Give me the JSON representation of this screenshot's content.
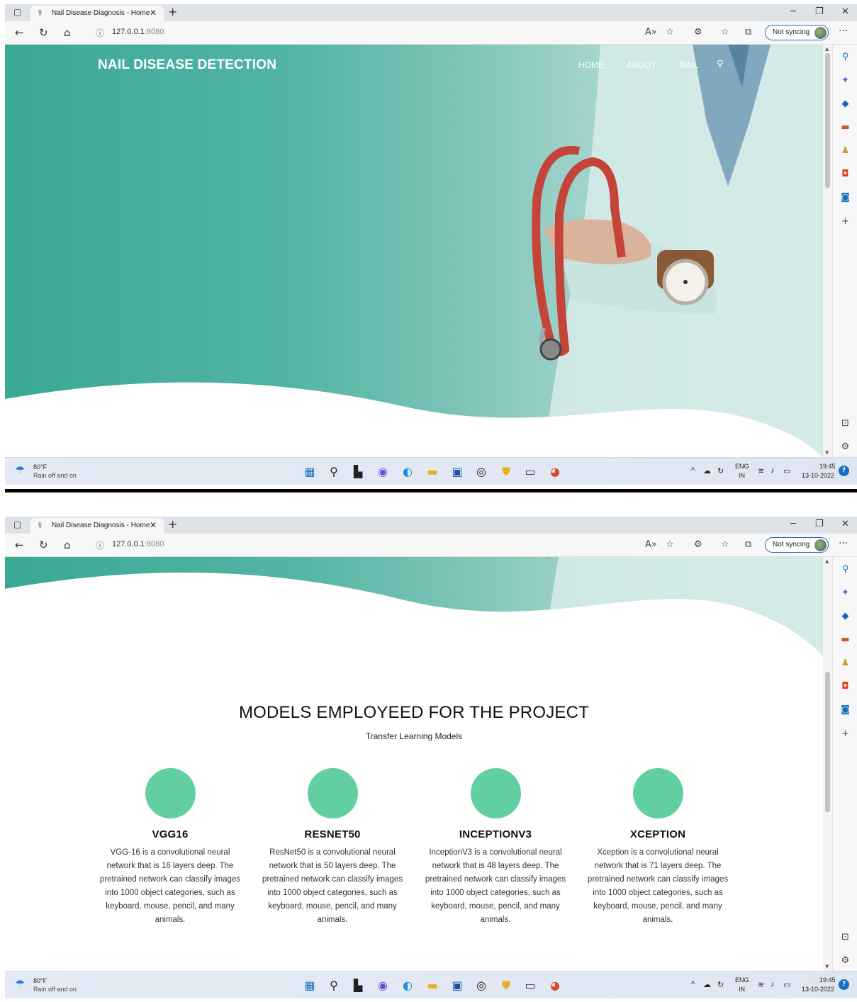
{
  "browser": {
    "tab_title": "Nail Disease Diagnosis - Home",
    "tab_close": "✕",
    "new_tab": "+",
    "url_host": "127.0.0.1",
    "url_port": ":8080",
    "sync_label": "Not syncing",
    "more": "···"
  },
  "site": {
    "brand": "NAIL DISEASE DETECTION",
    "menu": [
      "HOME",
      "ABOUT",
      "NAIL"
    ]
  },
  "taskbar": {
    "temp": "80°F",
    "weather": "Rain off and on",
    "lang_top": "ENG",
    "lang_bottom": "IN",
    "time": "19:45",
    "date": "13-10-2022"
  },
  "models_section": {
    "title": "MODELS EMPLOYEED FOR THE PROJECT",
    "subtitle": "Transfer Learning Models",
    "cards": [
      {
        "title": "VGG16",
        "desc": "VGG-16 is a convolutional neural network that is 16 layers deep. The pretrained network can classify images into 1000 object categories, such as keyboard, mouse, pencil, and many animals."
      },
      {
        "title": "RESNET50",
        "desc": "ResNet50 is a convolutional neural network that is 50 layers deep. The pretrained network can classify images into 1000 object categories, such as keyboard, mouse, pencil, and many animals."
      },
      {
        "title": "INCEPTIONV3",
        "desc": "InceptionV3 is a convolutional neural network that is 48 layers deep. The pretrained network can classify images into 1000 object categories, such as keyboard, mouse, pencil, and many animals."
      },
      {
        "title": "XCEPTION",
        "desc": "Xception is a convolutional neural network that is 71 layers deep. The pretrained network can classify images into 1000 object categories, such as keyboard, mouse, pencil, and many animals."
      }
    ]
  },
  "colors": {
    "teal_dark": "#3aa893",
    "teal_light": "#c2e1de",
    "circle_green": "#62cfa0",
    "accent_blue": "#1a6fc2"
  }
}
